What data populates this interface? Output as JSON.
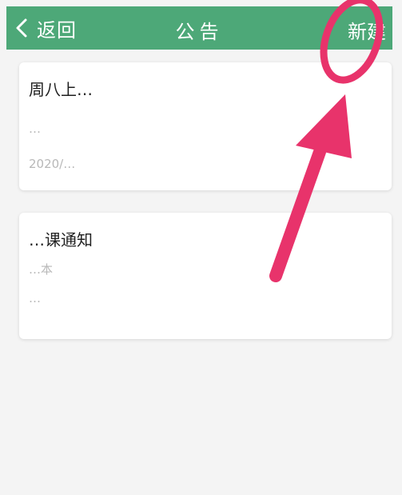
{
  "header": {
    "back_label": "返回",
    "title": "公告",
    "new_label": "新建"
  },
  "notices": [
    {
      "title": "周八上…",
      "line1": "…",
      "line2": "2020/…"
    },
    {
      "title": "…课通知",
      "line1": "…本",
      "line2": "…"
    }
  ],
  "colors": {
    "header_bg": "#4da878",
    "annotation": "#e8336b"
  }
}
